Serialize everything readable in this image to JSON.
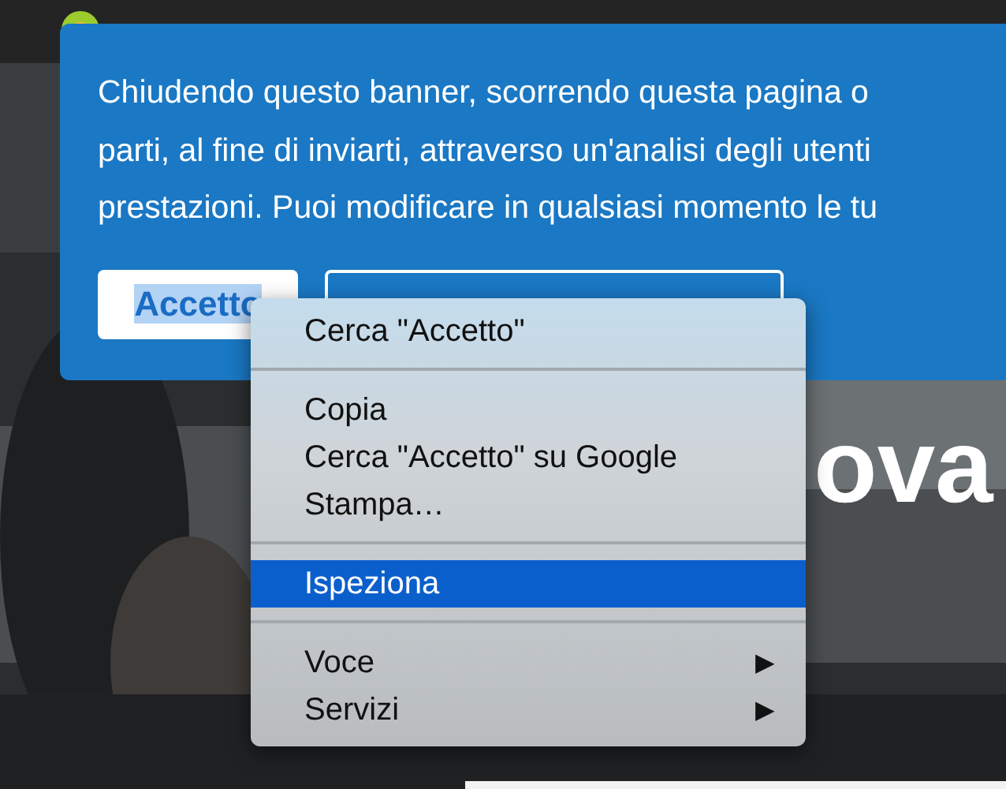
{
  "hero": {
    "headline": "ova"
  },
  "banner": {
    "lines": [
      "Chiudendo questo banner, scorrendo questa pagina o",
      "parti, al fine di inviarti, attraverso un'analisi degli utenti",
      "prestazioni. Puoi modificare in qualsiasi momento le tu"
    ],
    "buttons": [
      {
        "label": "Accetto",
        "kind": "primary",
        "text_selected": true
      },
      {
        "kind": "outline"
      }
    ]
  },
  "context_menu": {
    "items": [
      {
        "kind": "item",
        "label": "Cerca \"Accetto\"",
        "selected": false
      },
      {
        "kind": "separator"
      },
      {
        "kind": "item",
        "label": "Copia",
        "selected": false
      },
      {
        "kind": "item",
        "label": "Cerca \"Accetto\" su Google",
        "selected": false
      },
      {
        "kind": "item",
        "label": "Stampa…",
        "selected": false
      },
      {
        "kind": "separator"
      },
      {
        "kind": "item",
        "label": "Ispeziona",
        "selected": true
      },
      {
        "kind": "separator"
      },
      {
        "kind": "submenu",
        "label": "Voce",
        "arrow": "▶",
        "selected": false
      },
      {
        "kind": "submenu",
        "label": "Servizi",
        "arrow": "▶",
        "selected": false
      }
    ]
  }
}
